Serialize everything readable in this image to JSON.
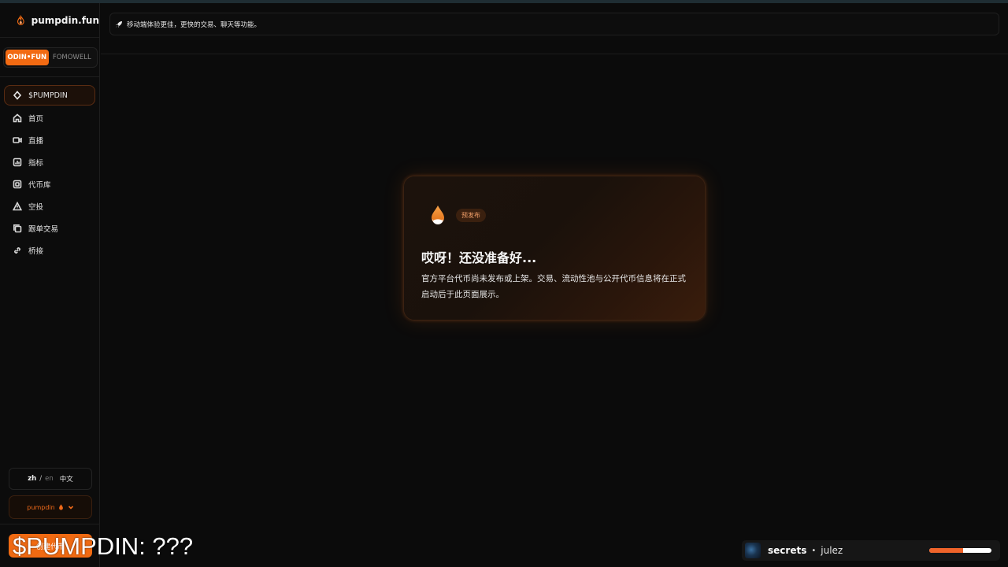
{
  "app": {
    "name": "pumpdin.fun"
  },
  "sidebar": {
    "switch": {
      "active": "ODIN•FUN",
      "inactive": "FOMOWELL"
    },
    "items": [
      {
        "label": "$PUMPDIN",
        "icon": "diamond-icon"
      },
      {
        "label": "首页",
        "icon": "home-icon"
      },
      {
        "label": "直播",
        "icon": "video-icon"
      },
      {
        "label": "指标",
        "icon": "chart-icon"
      },
      {
        "label": "代币库",
        "icon": "token-icon"
      },
      {
        "label": "空投",
        "icon": "airdrop-icon"
      },
      {
        "label": "跟单交易",
        "icon": "copy-icon"
      },
      {
        "label": "桥接",
        "icon": "link-icon"
      }
    ],
    "language": {
      "current": "zh",
      "separator": "/",
      "alternate": "en",
      "label": "中文"
    },
    "wallet": {
      "label": "pumpdin"
    },
    "cta": {
      "label": "创建代币"
    }
  },
  "banner": {
    "text": "移动端体验更佳，更快的交易、聊天等功能。"
  },
  "card": {
    "badge": "预发布",
    "title": "哎呀！还没准备好...",
    "description": "官方平台代币尚未发布或上架。交易、流动性池与公开代币信息将在正式启动后于此页面展示。"
  },
  "overlay": {
    "price_text": "$PUMPDIN: ???"
  },
  "player": {
    "song": "secrets",
    "separator": "•",
    "artist": "julez",
    "progress": 0.55
  },
  "colors": {
    "accent": "#f06a12",
    "background": "#0b0b0b",
    "progress": "#f0642a"
  }
}
